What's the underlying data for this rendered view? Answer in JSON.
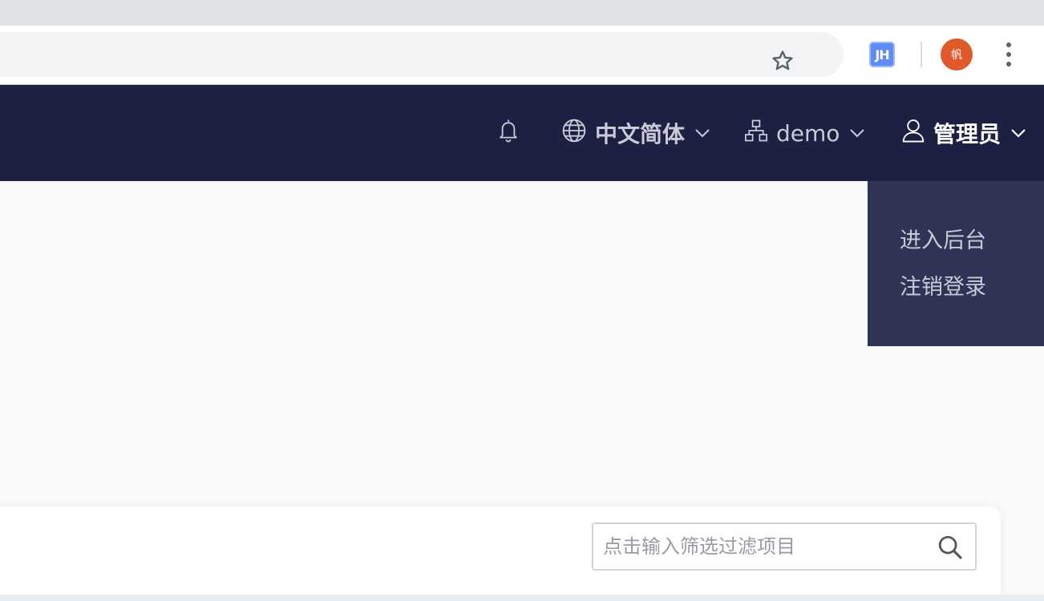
{
  "browser": {
    "extension_label": "JH",
    "profile_initial": "帆",
    "icons": {
      "bookmark": "star-icon",
      "menu": "kebab-menu-icon"
    }
  },
  "header": {
    "notifications_icon": "bell-icon",
    "language": {
      "icon": "globe-icon",
      "label": "中文简体"
    },
    "organization": {
      "icon": "sitemap-icon",
      "label": "demo"
    },
    "user": {
      "icon": "user-icon",
      "label": "管理员"
    },
    "background_color": "#1d2042"
  },
  "user_menu": {
    "items": [
      {
        "label": "进入后台"
      },
      {
        "label": "注销登录"
      }
    ],
    "background_color": "#2f3355"
  },
  "filter": {
    "placeholder": "点击输入筛选过滤项目",
    "value": "",
    "icon": "search-icon"
  }
}
